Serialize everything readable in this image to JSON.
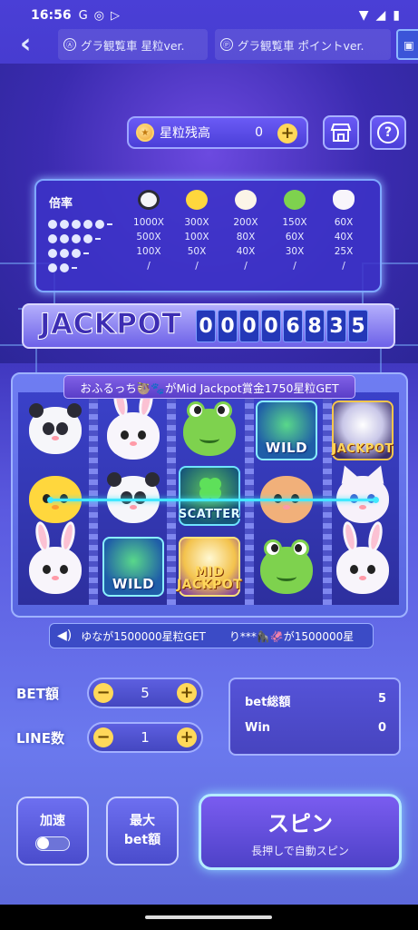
{
  "status_bar": {
    "time": "16:56",
    "icons": [
      "G",
      "◎",
      "▷"
    ]
  },
  "tabs": [
    {
      "icon": "Ⓐ",
      "label": "グラ観覧車 星粒ver."
    },
    {
      "icon": "Ⓟ",
      "label": "グラ観覧車 ポイントver."
    }
  ],
  "balance": {
    "label": "星粒残高",
    "value": "0"
  },
  "paytable": {
    "title": "倍率",
    "columns": [
      {
        "animal": "panda",
        "values": [
          "1000X",
          "500X",
          "100X",
          "/"
        ]
      },
      {
        "animal": "chick",
        "values": [
          "300X",
          "100X",
          "50X",
          "/"
        ]
      },
      {
        "animal": "sheep",
        "values": [
          "200X",
          "80X",
          "40X",
          "/"
        ]
      },
      {
        "animal": "frog",
        "values": [
          "150X",
          "60X",
          "30X",
          "/"
        ]
      },
      {
        "animal": "bunny",
        "values": [
          "60X",
          "40X",
          "25X",
          "/"
        ]
      }
    ]
  },
  "jackpot": {
    "label": "JACKPOT",
    "digits": [
      "0",
      "0",
      "0",
      "0",
      "6",
      "8",
      "3",
      "5"
    ]
  },
  "win_banner": "おふるっち🦥🐾がMid Jackpot賞金1750星粒GET",
  "reels": {
    "wild_label": "WILD",
    "jackpot_label": "JACKPOT",
    "scatter_label": "SCATTER",
    "mid_label": "MID",
    "midjp_label": "JACKPOT"
  },
  "ticker": {
    "message1": "ゆなが1500000星粒GET",
    "message2": "り***🦍🦑が1500000星"
  },
  "bet": {
    "label": "BET額",
    "value": "5"
  },
  "line": {
    "label": "LINE数",
    "value": "1"
  },
  "totals": {
    "bet_total_label": "bet総額",
    "bet_total_value": "5",
    "win_label": "Win",
    "win_value": "0"
  },
  "buttons": {
    "speed_label": "加速",
    "max_bet_line1": "最大",
    "max_bet_line2": "bet額",
    "spin_label": "スピン",
    "spin_sub": "長押しで自動スピン"
  },
  "colors": {
    "accent": "#ffd85a",
    "payline": "#43e8ff",
    "jackpot_text": "#3d2db3"
  }
}
